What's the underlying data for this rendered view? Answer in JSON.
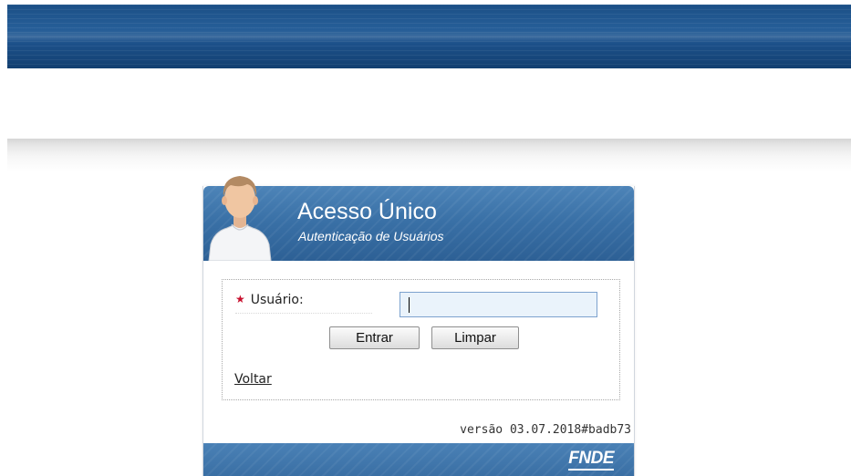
{
  "login": {
    "title": "Acesso Único",
    "subtitle": "Autenticação de Usuários",
    "username_label": "Usuário:",
    "username_value": "",
    "required_marker": "★",
    "enter_button": "Entrar",
    "clear_button": "Limpar",
    "back_link": "Voltar",
    "version": "versão 03.07.2018#badb73",
    "footer_logo": "FNDE"
  },
  "colors": {
    "banner": "#1b4f86",
    "header": "#3a71a7",
    "required": "#c8102e",
    "input_bg": "#eaf3fb"
  },
  "icons": {
    "avatar": "user-avatar-icon",
    "required": "required-asterisk-icon"
  }
}
